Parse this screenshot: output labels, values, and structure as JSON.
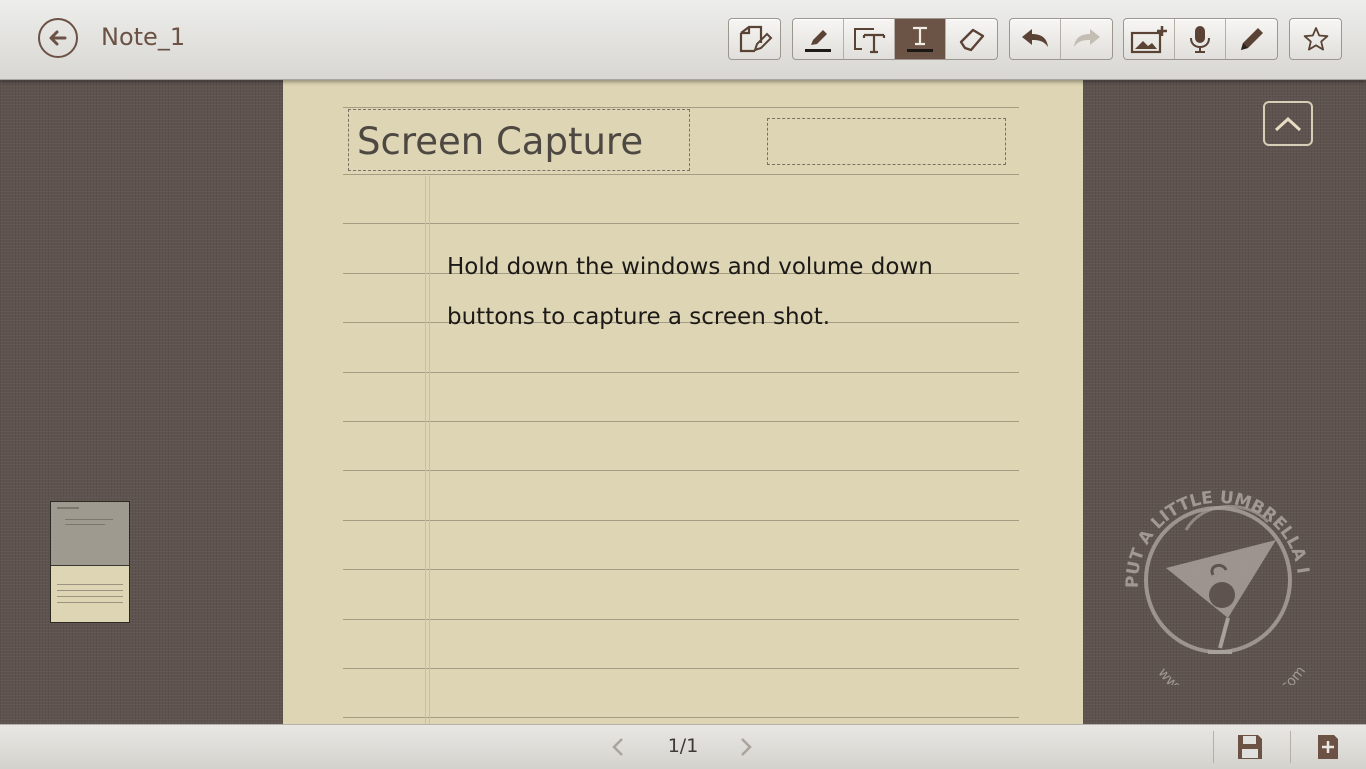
{
  "header": {
    "title": "Note_1",
    "back_icon": "back-arrow-icon"
  },
  "toolbar": {
    "groups": [
      {
        "name": "page-style",
        "tools": [
          {
            "name": "page-edit",
            "icon": "page-edit-icon"
          }
        ]
      },
      {
        "name": "input-modes",
        "tools": [
          {
            "name": "pen",
            "icon": "pen-icon"
          },
          {
            "name": "textbox",
            "icon": "textbox-icon"
          },
          {
            "name": "text",
            "icon": "text-cursor-icon",
            "active": true
          },
          {
            "name": "eraser",
            "icon": "eraser-icon"
          }
        ]
      },
      {
        "name": "history",
        "tools": [
          {
            "name": "undo",
            "icon": "undo-icon"
          },
          {
            "name": "redo",
            "icon": "redo-icon",
            "disabled": true
          }
        ]
      },
      {
        "name": "insert",
        "tools": [
          {
            "name": "insert-image",
            "icon": "add-image-icon"
          },
          {
            "name": "record-audio",
            "icon": "microphone-icon"
          },
          {
            "name": "pencil",
            "icon": "pencil-icon"
          }
        ]
      },
      {
        "name": "favorite",
        "tools": [
          {
            "name": "favorite",
            "icon": "star-icon"
          }
        ]
      }
    ]
  },
  "note": {
    "title": "Screen Capture",
    "date_value": "",
    "body": "Hold down the windows and volume down buttons to capture a screen shot."
  },
  "watermark": {
    "text": "PUT A LITTLE UMBRELLA IN YOUR DRINK",
    "url": "www.alittleumbrella.com"
  },
  "footer": {
    "page_indicator": "1/1",
    "prev_icon": "chevron-left-icon",
    "next_icon": "chevron-right-icon",
    "save_icon": "save-icon",
    "add_page_icon": "add-page-icon"
  },
  "colors": {
    "accent": "#6b5446",
    "paper": "#ded5b4",
    "background": "#5e534f",
    "toolbar": "#e4e2de"
  }
}
